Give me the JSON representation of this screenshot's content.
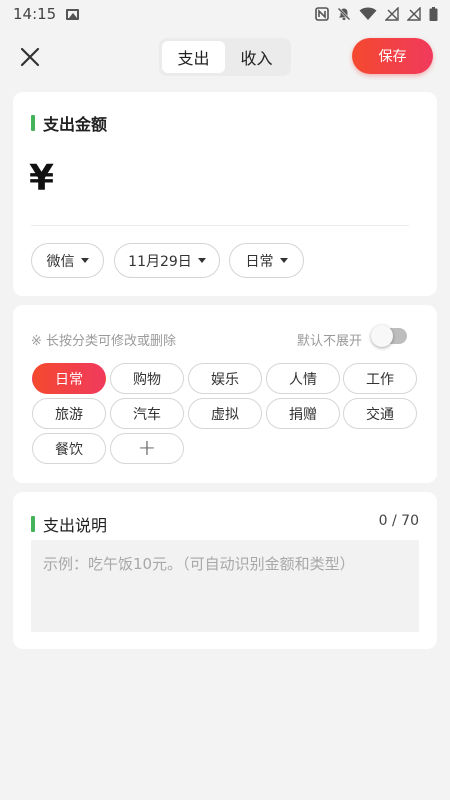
{
  "status_bar": {
    "time": "14:15",
    "icons": [
      "image-icon",
      "nfc-icon",
      "mute-icon",
      "wifi-icon",
      "no-signal-icon",
      "no-signal-icon",
      "battery-icon"
    ]
  },
  "header": {
    "close_icon": "close-icon",
    "tabs": [
      {
        "label": "支出",
        "active": true
      },
      {
        "label": "收入",
        "active": false
      }
    ],
    "save_label": "保存"
  },
  "amount_section": {
    "title": "支出金额",
    "currency": "¥",
    "selectors": [
      {
        "label": "微信"
      },
      {
        "label": "11月29日"
      },
      {
        "label": "日常"
      }
    ]
  },
  "category_section": {
    "hint": "※ 长按分类可修改或删除",
    "toggle_label": "默认不展开",
    "toggle_on": false,
    "categories": [
      {
        "label": "日常",
        "active": true
      },
      {
        "label": "购物",
        "active": false
      },
      {
        "label": "娱乐",
        "active": false
      },
      {
        "label": "人情",
        "active": false
      },
      {
        "label": "工作",
        "active": false
      },
      {
        "label": "旅游",
        "active": false
      },
      {
        "label": "汽车",
        "active": false
      },
      {
        "label": "虚拟",
        "active": false
      },
      {
        "label": "捐赠",
        "active": false
      },
      {
        "label": "交通",
        "active": false
      },
      {
        "label": "餐饮",
        "active": false
      }
    ],
    "add_label": "+"
  },
  "note_section": {
    "title": "支出说明",
    "counter": "0 / 70",
    "placeholder": "示例：吃午饭10元。（可自动识别金额和类型）",
    "value": ""
  },
  "colors": {
    "accent_start": "#f4492f",
    "accent_end": "#f13a5d",
    "section_marker": "#44b35a",
    "background": "#f3f3f3"
  }
}
